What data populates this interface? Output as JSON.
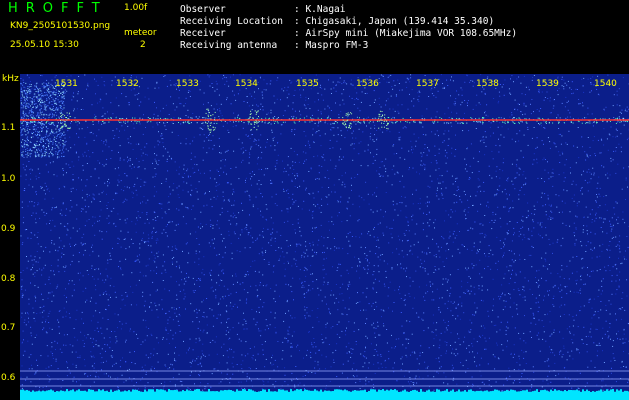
{
  "header": {
    "app_title": "HROFFT",
    "version": "1.00f",
    "filename": "KN9_2505101530.png",
    "mode": "meteor",
    "datetime": "25.05.10 15:30",
    "count": "2",
    "info": [
      {
        "key": "Observer",
        "value": ": K.Nagai"
      },
      {
        "key": "Receiving Location",
        "value": ": Chigasaki, Japan (139.414 35.340)"
      },
      {
        "key": "Receiver",
        "value": ": AirSpy mini (Miakejima VOR 108.65MHz)"
      },
      {
        "key": "Receiving antenna",
        "value": ": Maspro FM-3"
      }
    ]
  },
  "plot": {
    "unit": "kHz",
    "time_ticks": [
      "1531",
      "1532",
      "1533",
      "1534",
      "1535",
      "1536",
      "1537",
      "1538",
      "1539",
      "1540"
    ],
    "freq_labels": [
      "1.1",
      "1.0",
      "0.9",
      "0.8",
      "0.7",
      "0.6"
    ],
    "colors": {
      "background": "#0b1e8a",
      "tick_text": "#ffff00",
      "carrier": "#ff3030",
      "floor": "#00e5ff"
    }
  }
}
